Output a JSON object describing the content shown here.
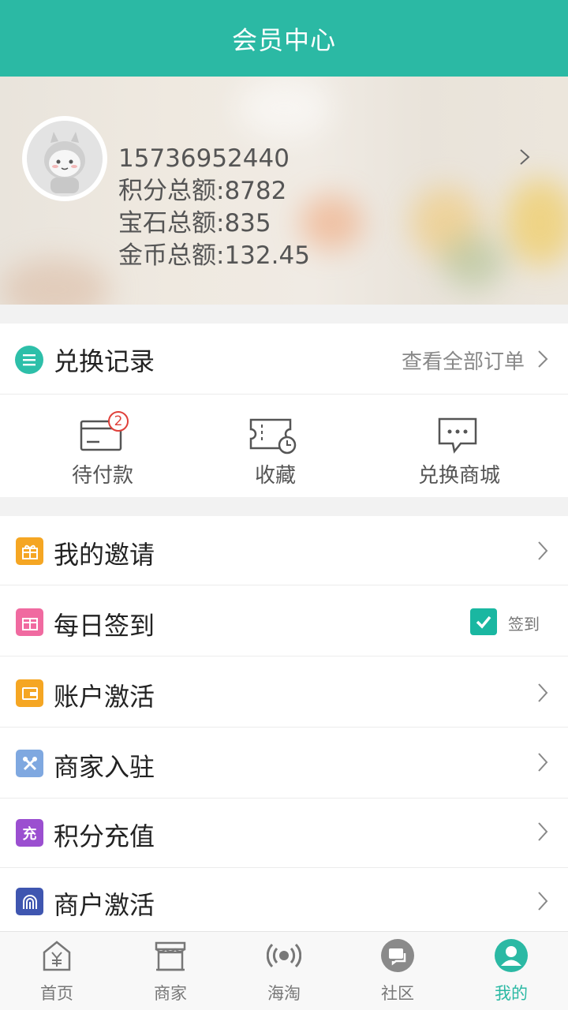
{
  "header": {
    "title": "会员中心"
  },
  "profile": {
    "phone": "15736952440",
    "points": "积分总额:8782",
    "gems": "宝石总额:835",
    "coins": "金币总额:132.45"
  },
  "exchange": {
    "title": "兑换记录",
    "view_all": "查看全部订单",
    "shortcuts": [
      {
        "label": "待付款",
        "badge": "2",
        "icon": "card-icon"
      },
      {
        "label": "收藏",
        "icon": "ticket-clock-icon"
      },
      {
        "label": "兑换商城",
        "icon": "chat-bubble-icon"
      }
    ]
  },
  "menu": {
    "items": [
      {
        "label": "我的邀请",
        "icon": "gift-icon",
        "color": "#f5a623"
      },
      {
        "label": "每日签到",
        "icon": "gift-box-icon",
        "color": "#f06aa0",
        "checkin_label": "签到"
      },
      {
        "label": "账户激活",
        "icon": "wallet-icon",
        "color": "#f5a623"
      },
      {
        "label": "商家入驻",
        "icon": "tools-icon",
        "color": "#7fa8e0"
      },
      {
        "label": "积分充值",
        "icon": "recharge-icon",
        "color": "#9b4fd0",
        "icon_text": "充"
      },
      {
        "label": "商户激活",
        "icon": "fingerprint-icon",
        "color": "#3f56b0"
      }
    ]
  },
  "tabbar": {
    "tabs": [
      {
        "label": "首页",
        "icon": "home-yen-icon"
      },
      {
        "label": "商家",
        "icon": "store-icon"
      },
      {
        "label": "海淘",
        "icon": "broadcast-icon"
      },
      {
        "label": "社区",
        "icon": "community-chat-icon"
      },
      {
        "label": "我的",
        "icon": "user-icon",
        "active": true
      }
    ]
  },
  "colors": {
    "accent": "#2bb9a4",
    "badge": "#e0403a"
  }
}
